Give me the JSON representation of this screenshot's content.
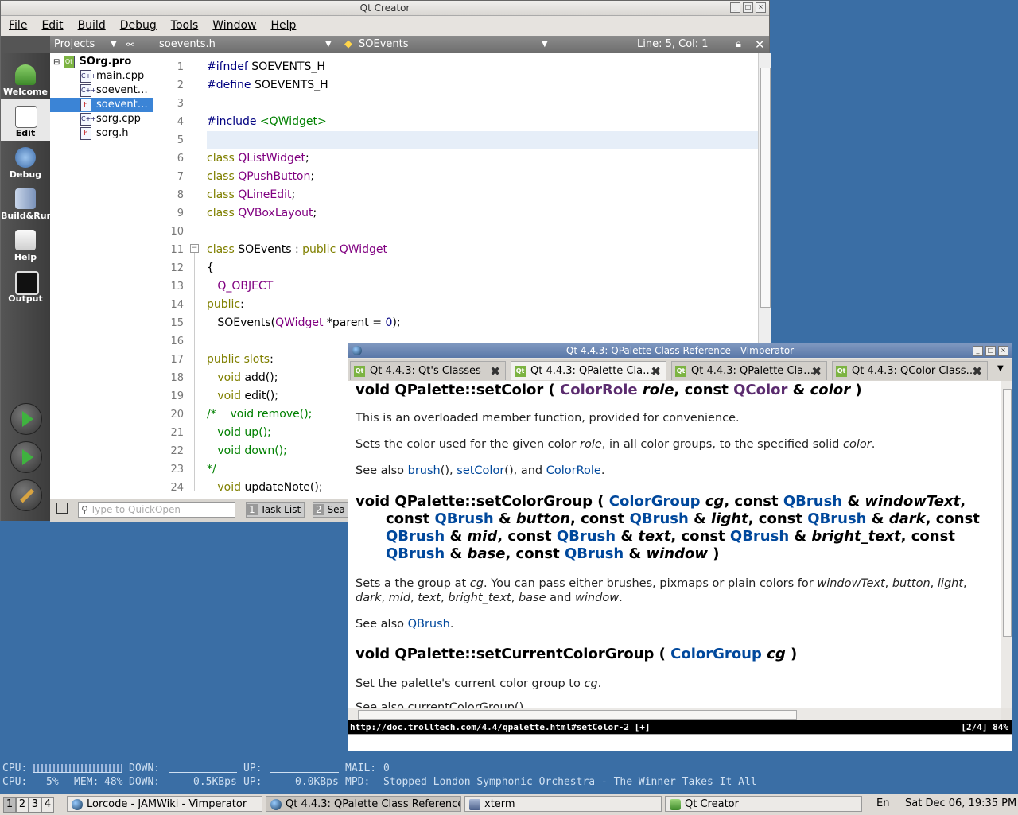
{
  "qtcreator": {
    "title": "Qt Creator",
    "menu": [
      "File",
      "Edit",
      "Build",
      "Debug",
      "Tools",
      "Window",
      "Help"
    ],
    "modes": [
      "Welcome",
      "Edit",
      "Debug",
      "Build&Run",
      "Help",
      "Output"
    ],
    "projects_label": "Projects",
    "tree": {
      "root": "SOrg.pro",
      "files": [
        "main.cpp",
        "soevent…",
        "soevent…",
        "sorg.cpp",
        "sorg.h"
      ]
    },
    "editor": {
      "filename": "soevents.h",
      "symbol": "SOEvents",
      "position": "Line: 5, Col: 1",
      "line_numbers": [
        "1",
        "2",
        "3",
        "4",
        "5",
        "6",
        "7",
        "8",
        "9",
        "10",
        "11",
        "12",
        "13",
        "14",
        "15",
        "16",
        "17",
        "18",
        "19",
        "20",
        "21",
        "22",
        "23",
        "24"
      ]
    },
    "status": {
      "quickopen_placeholder": "Type to QuickOpen",
      "tab1_num": "1",
      "tab1": "Task List",
      "tab2_num": "2",
      "tab2": "Sea"
    }
  },
  "vimperator": {
    "title": "Qt 4.4.3: QPalette Class Reference - Vimperator",
    "tabs": [
      "Qt 4.4.3: Qt's Classes",
      "Qt 4.4.3: QPalette Cla…",
      "Qt 4.4.3: QPalette Cla…",
      "Qt 4.4.3: QColor Class…"
    ],
    "doc": {
      "overloaded": "This is an overloaded member function, provided for convenience.",
      "sets_color_1": "Sets the color used for the given color ",
      "sets_color_role": "role",
      "sets_color_2": ", in all color groups, to the specified solid ",
      "sets_color_color": "color",
      "see_also": "See also ",
      "link_brush": "brush",
      "link_setcolor": "setColor",
      "link_colorrole": "ColorRole",
      "link_qbrush": "QBrush",
      "link_colorgroup": "ColorGroup",
      "setgroup_text_1": "Sets a the group at ",
      "setgroup_text_2": "You can pass either brushes, pixmaps or plain colors for ",
      "set_current": "Set the palette's current color group to ",
      "cut_off": "See also currentColorGroup()."
    },
    "url": "http://doc.trolltech.com/4.4/qpalette.html#setColor-2 [+]",
    "url_right": "[2/4]  84%"
  },
  "conky": {
    "cpu_label": "CPU:",
    "down_label": "DOWN:",
    "up_label": "UP:",
    "mail_label": "MAIL:",
    "mail_value": "0",
    "cpu_value": "5%",
    "mem_label": "MEM:",
    "mem_value": "48%",
    "down_value": "0.5KBps",
    "up_value": "0.0KBps",
    "mpd_label": "MPD:",
    "mpd_value": "Stopped London Symphonic Orchestra - The Winner Takes It All"
  },
  "taskbar": {
    "workspaces": [
      "1",
      "2",
      "3",
      "4"
    ],
    "tasks": [
      "Lorcode - JAMWiki - Vimperator",
      "Qt 4.4.3: QPalette Class Reference",
      "xterm",
      "Qt Creator"
    ],
    "layout": "En",
    "clock": "Sat Dec 06, 19:35 PM"
  }
}
